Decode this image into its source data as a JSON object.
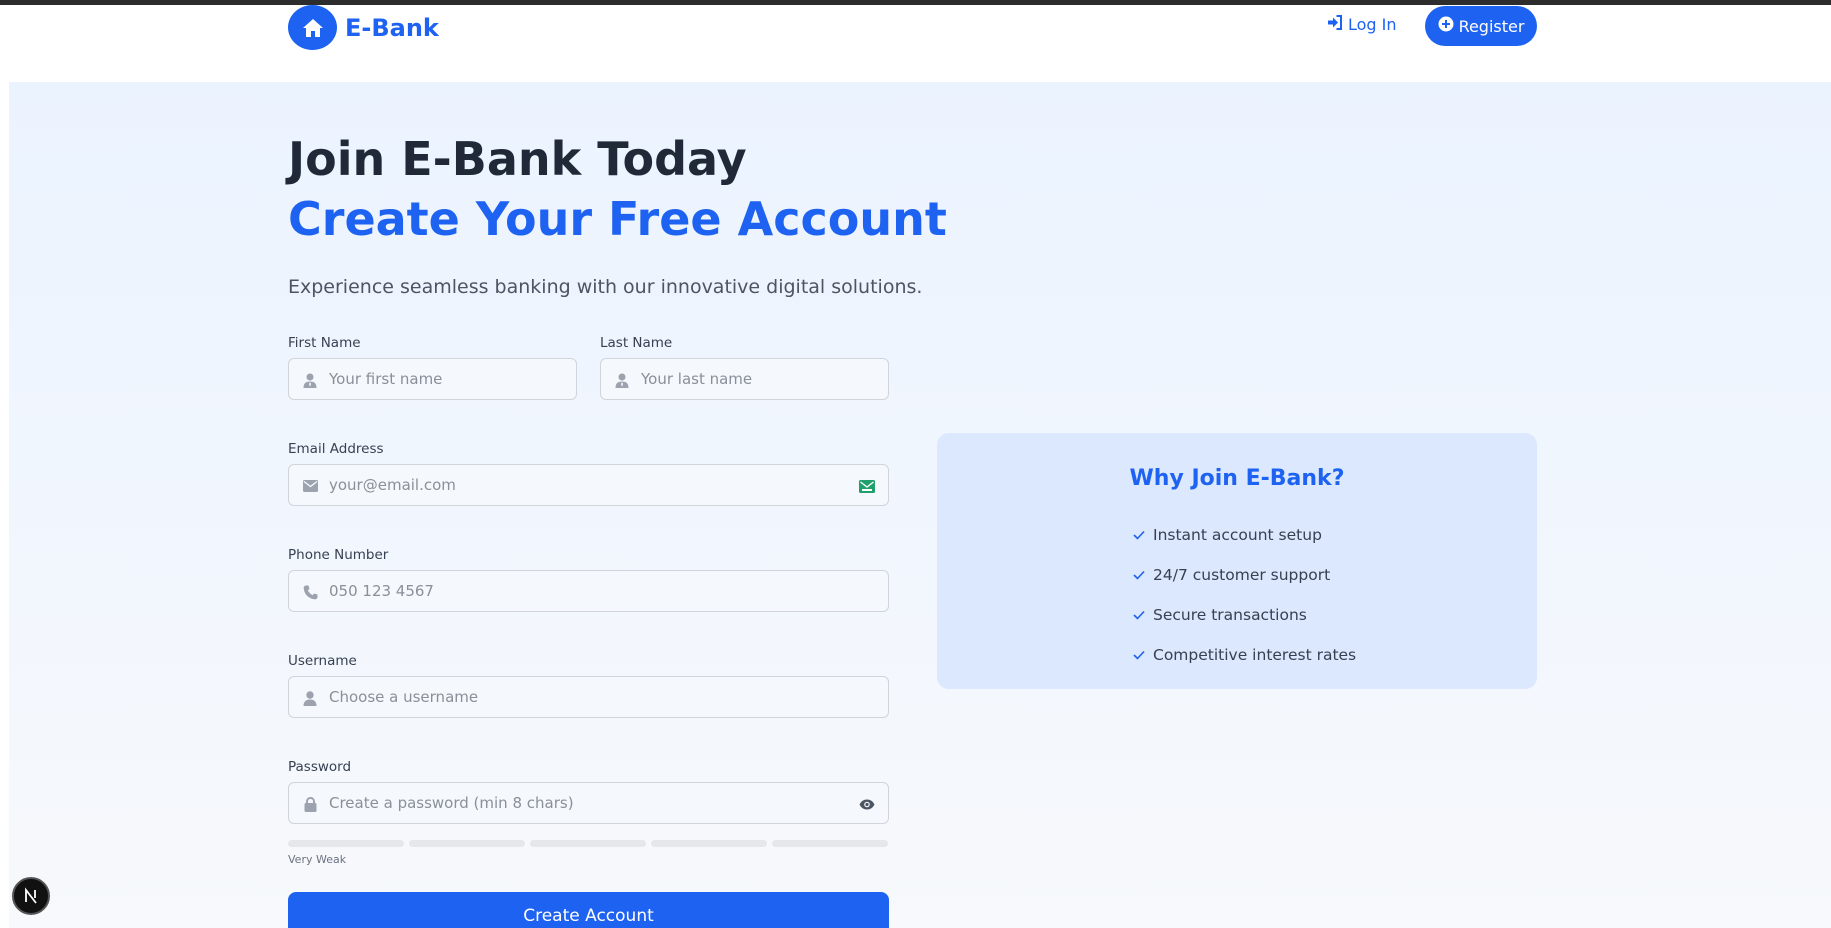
{
  "nav": {
    "brand": "E-Bank",
    "login_label": "Log In",
    "register_label": "Register"
  },
  "hero": {
    "title_line1": "Join E-Bank Today",
    "title_line2": "Create Your Free Account",
    "subtitle": "Experience seamless banking with our innovative digital solutions."
  },
  "form": {
    "first_name": {
      "label": "First Name",
      "placeholder": "Your first name",
      "value": ""
    },
    "last_name": {
      "label": "Last Name",
      "placeholder": "Your last name",
      "value": ""
    },
    "email": {
      "label": "Email Address",
      "placeholder": "your@email.com",
      "value": ""
    },
    "phone": {
      "label": "Phone Number",
      "placeholder": "050 123 4567",
      "value": ""
    },
    "username": {
      "label": "Username",
      "placeholder": "Choose a username",
      "value": ""
    },
    "password": {
      "label": "Password",
      "placeholder": "Create a password (min 8 chars)",
      "value": ""
    },
    "strength": {
      "label": "Very Weak",
      "level": 0,
      "segments": 5
    },
    "submit_label": "Create Account"
  },
  "why": {
    "title": "Why Join E-Bank?",
    "items": [
      "Instant account setup",
      "24/7 customer support",
      "Secure transactions",
      "Competitive interest rates"
    ]
  },
  "icons": {
    "brand": "home-icon",
    "login": "sign-in-icon",
    "register": "plus-circle-icon",
    "first_name": "user-tie-icon",
    "last_name": "user-tie-icon",
    "email": "envelope-icon",
    "email_status": "email-check-icon",
    "phone": "phone-icon",
    "username": "user-icon",
    "password": "lock-icon",
    "password_toggle": "eye-icon",
    "why_item": "check-icon",
    "dev_badge": "nextjs-icon"
  },
  "colors": {
    "primary": "#1d62f0",
    "heading": "#1f2937",
    "card_bg": "#dbe8fd",
    "email_status": "#22a06b"
  }
}
